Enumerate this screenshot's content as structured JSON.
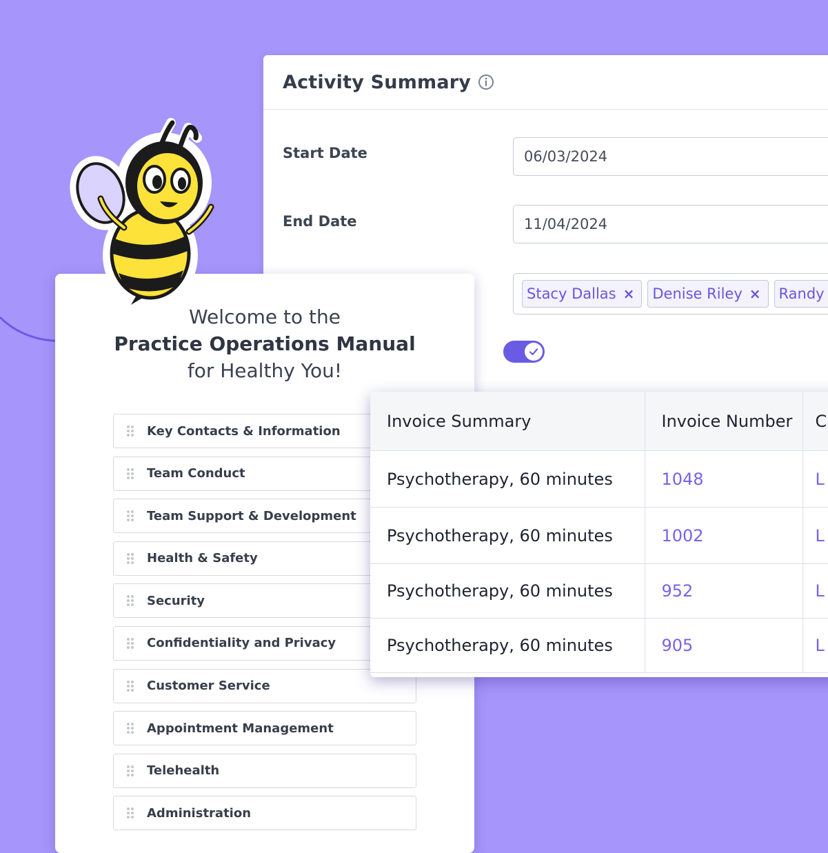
{
  "activity_summary": {
    "title": "Activity Summary",
    "info_icon": "info-circle-icon",
    "start_date": {
      "label": "Start Date",
      "value": "06/03/2024"
    },
    "end_date": {
      "label": "End Date",
      "value": "11/04/2024"
    },
    "staff_tags": [
      "Stacy Dallas",
      "Denise Riley",
      "Randy Tra"
    ],
    "tag_remove_glyph": "×",
    "toggle": {
      "checked": true,
      "icon": "check-icon"
    }
  },
  "manual": {
    "welcome_line1": "Welcome to the",
    "welcome_line2": "Practice Operations Manual",
    "welcome_line3": "for Healthy You!",
    "items": [
      "Key Contacts & Information",
      "Team Conduct",
      "Team Support & Development",
      "Health & Safety",
      "Security",
      "Confidentiality and Privacy",
      "Customer Service",
      "Appointment Management",
      "Telehealth",
      "Administration"
    ]
  },
  "invoice_table": {
    "headers": [
      "Invoice Summary",
      "Invoice Number",
      "C"
    ],
    "rows": [
      {
        "summary": "Psychotherapy, 60 minutes",
        "number": "1048",
        "extra": "L"
      },
      {
        "summary": "Psychotherapy, 60 minutes",
        "number": "1002",
        "extra": "L"
      },
      {
        "summary": "Psychotherapy, 60 minutes",
        "number": "952",
        "extra": "L"
      },
      {
        "summary": "Psychotherapy, 60 minutes",
        "number": "905",
        "extra": "L"
      }
    ]
  },
  "colors": {
    "background": "#a695fb",
    "accent": "#6a56dd",
    "link": "#7a62e8",
    "bee_yellow": "#fde23a"
  },
  "mascot": "bee-mascot-icon"
}
